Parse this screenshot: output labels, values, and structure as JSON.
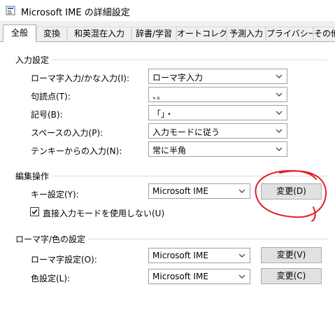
{
  "window": {
    "title": "Microsoft IME の詳細設定"
  },
  "tabs": [
    {
      "label": "全般",
      "active": true
    },
    {
      "label": "変換"
    },
    {
      "label": "和英混在入力"
    },
    {
      "label": "辞書/学習"
    },
    {
      "label": "オートコレクト"
    },
    {
      "label": "予測入力"
    },
    {
      "label": "プライバシー"
    },
    {
      "label": "その他"
    }
  ],
  "input_settings": {
    "title": "入力設定",
    "rows": [
      {
        "label": "ローマ字入力/かな入力(I):",
        "value": "ローマ字入力"
      },
      {
        "label": "句読点(T):",
        "value": "、。"
      },
      {
        "label": "記号(B):",
        "value": "「」・"
      },
      {
        "label": "スペースの入力(P):",
        "value": "入力モードに従う"
      },
      {
        "label": "テンキーからの入力(N):",
        "value": "常に半角"
      }
    ]
  },
  "edit_operations": {
    "title": "編集操作",
    "key_setting_label": "キー設定(Y):",
    "key_setting_value": "Microsoft IME",
    "change_button": "変更(D)",
    "checkbox_label": "直接入力モードを使用しない(U)",
    "checkbox_checked": true
  },
  "romaji_color": {
    "title": "ローマ字/色の設定",
    "romaji_label": "ローマ字設定(O):",
    "romaji_value": "Microsoft IME",
    "romaji_button": "変更(V)",
    "color_label": "色設定(L):",
    "color_value": "Microsoft IME",
    "color_button": "変更(C)"
  },
  "colors": {
    "annotation": "#e0202a"
  }
}
